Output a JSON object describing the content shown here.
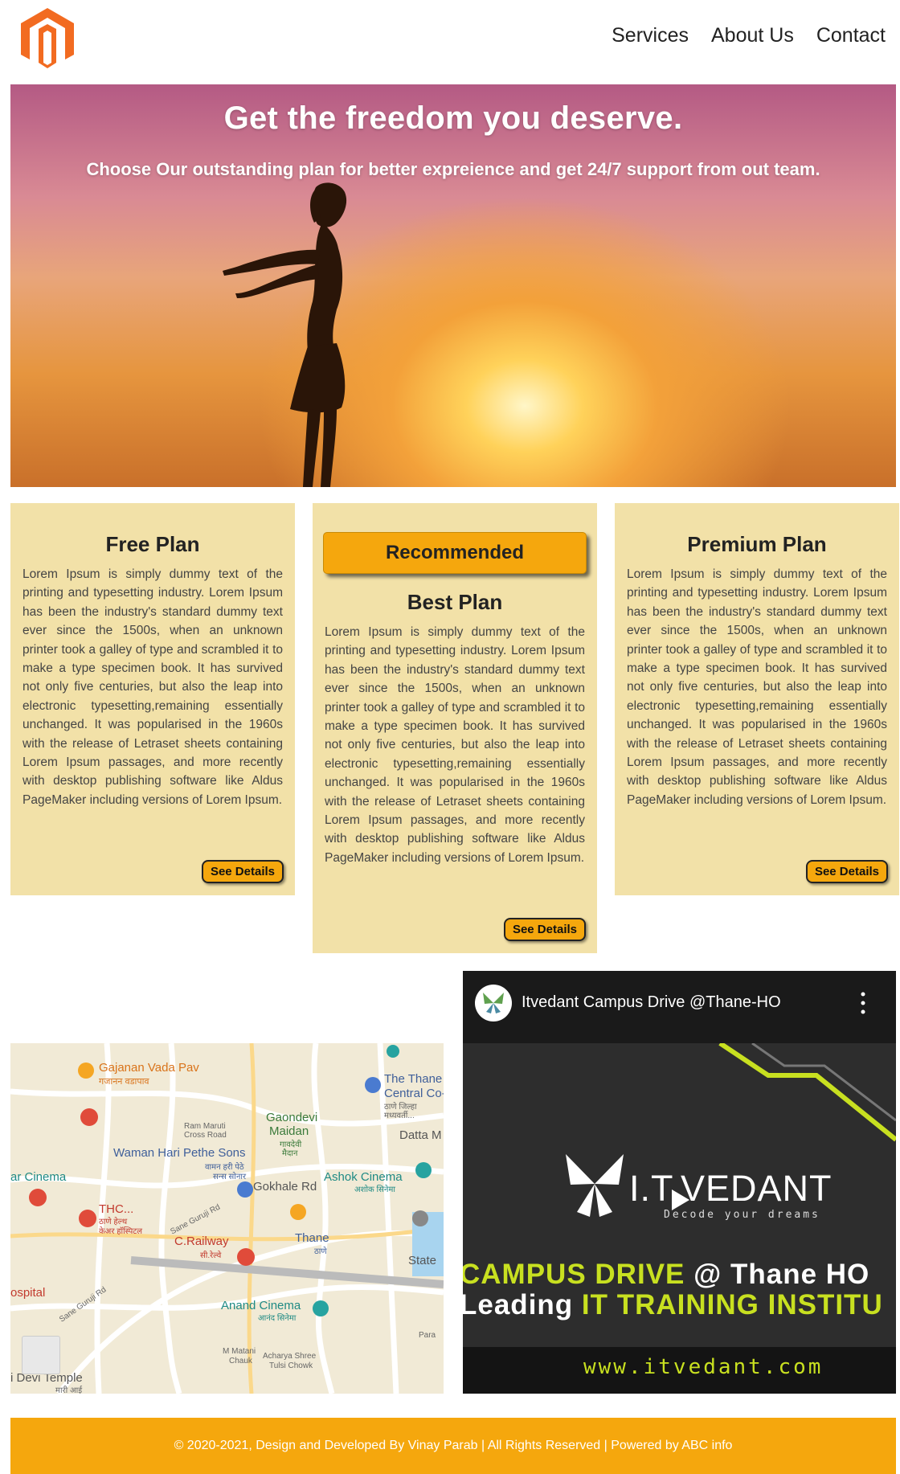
{
  "nav": {
    "items": [
      "Services",
      "About Us",
      "Contact"
    ]
  },
  "hero": {
    "title": "Get the freedom you deserve.",
    "subtitle": "Choose Our outstanding plan for better expreience and get 24/7 support from out team."
  },
  "plans": [
    {
      "title": "Free Plan",
      "description": "Lorem Ipsum is simply dummy text of the printing and typesetting industry. Lorem Ipsum has been the industry's standard dummy text ever since the 1500s, when an unknown printer took a galley of type and scrambled it to make a type specimen book. It has survived not only five centuries, but also the leap into electronic typesetting,remaining essentially unchanged. It was popularised in the 1960s with the release of Letraset sheets containing Lorem Ipsum passages, and more recently with desktop publishing software like Aldus PageMaker including versions of Lorem Ipsum.",
      "button": "See Details"
    },
    {
      "badge": "Recommended",
      "title": "Best Plan",
      "description": "Lorem Ipsum is simply dummy text of the printing and typesetting industry. Lorem Ipsum has been the industry's standard dummy text ever since the 1500s, when an unknown printer took a galley of type and scrambled it to make a type specimen book. It has survived not only five centuries, but also the leap into electronic typesetting,remaining essentially unchanged. It was popularised in the 1960s with the release of Letraset sheets containing Lorem Ipsum passages, and more recently with desktop publishing software like Aldus PageMaker including versions of Lorem Ipsum.",
      "button": "See Details"
    },
    {
      "title": "Premium Plan",
      "description": "Lorem Ipsum is simply dummy text of the printing and typesetting industry. Lorem Ipsum has been the industry's standard dummy text ever since the 1500s, when an unknown printer took a galley of type and scrambled it to make a type specimen book. It has survived not only five centuries, but also the leap into electronic typesetting,remaining essentially unchanged. It was popularised in the 1960s with the release of Letraset sheets containing Lorem Ipsum passages, and more recently with desktop publishing software like Aldus PageMaker including versions of Lorem Ipsum.",
      "button": "See Details"
    }
  ],
  "map": {
    "labels": {
      "gajanan": "Gajanan Vada Pav",
      "gajanan_local": "गजानन वडापाव",
      "thane_central": "The Thane I",
      "central_co": "Central Co-(",
      "central_local": "ठाणे जिल्हा",
      "central_local2": "मध्यवर्ती...",
      "ram_maruti": "Ram Maruti",
      "cross_road": "Cross Road",
      "gaondevi": "Gaondevi",
      "maidan": "Maidan",
      "maidan_local": "गावदेवी",
      "maidan_local2": "मैदान",
      "datta": "Datta M",
      "waman": "Waman Hari Pethe Sons",
      "waman_local": "वामन हरी पेठे",
      "waman_local2": "सन्स सोनार",
      "cinema": "ar Cinema",
      "gokhale": "Gokhale Rd",
      "ashok": "Ashok Cinema",
      "ashok_local": "अशोक सिनेमा",
      "thc": "THC...",
      "thc_local": "ठाणे हेल्थ",
      "thc_local2": "केअर हॉस्पिटल",
      "sane_guruji": "Sane Guruji Rd",
      "c_railway": "C.Railway",
      "c_railway_local": "सी.रेल्वे",
      "thane": "Thane",
      "thane_local": "ठाणे",
      "state": "State",
      "hospital": "ospital",
      "anand": "Anand Cinema",
      "anand_local": "आनंद सिनेमा",
      "sane_guruji2": "Sane Guruji Rd",
      "para": "Para",
      "m_matani": "M Matani",
      "chauk": "Chauk",
      "acharya": "Acharya Shree",
      "tulsi": "Tulsi Chowk",
      "devi_temple": "i Devi Temple",
      "devi_local": "मारी आई"
    }
  },
  "video": {
    "title": "Itvedant Campus Drive @Thane-HO",
    "brand": "I.T.VEDANT",
    "tagline": "Decode your dreams",
    "drive_a": "CAMPUS DRI",
    "drive_b": "VE",
    "drive_c": " @ Thane HO",
    "lead_a": "Leading ",
    "lead_b": "IT TRAINING INSTITU",
    "url": "www.itvedant.com"
  },
  "footer": {
    "text": "© 2020-2021, Design and Developed By Vinay Parab | All Rights Reserved | Powered by ABC info"
  },
  "colors": {
    "accent": "#f5a70d",
    "card": "#f2e1a8",
    "logo": "#f26b21"
  }
}
